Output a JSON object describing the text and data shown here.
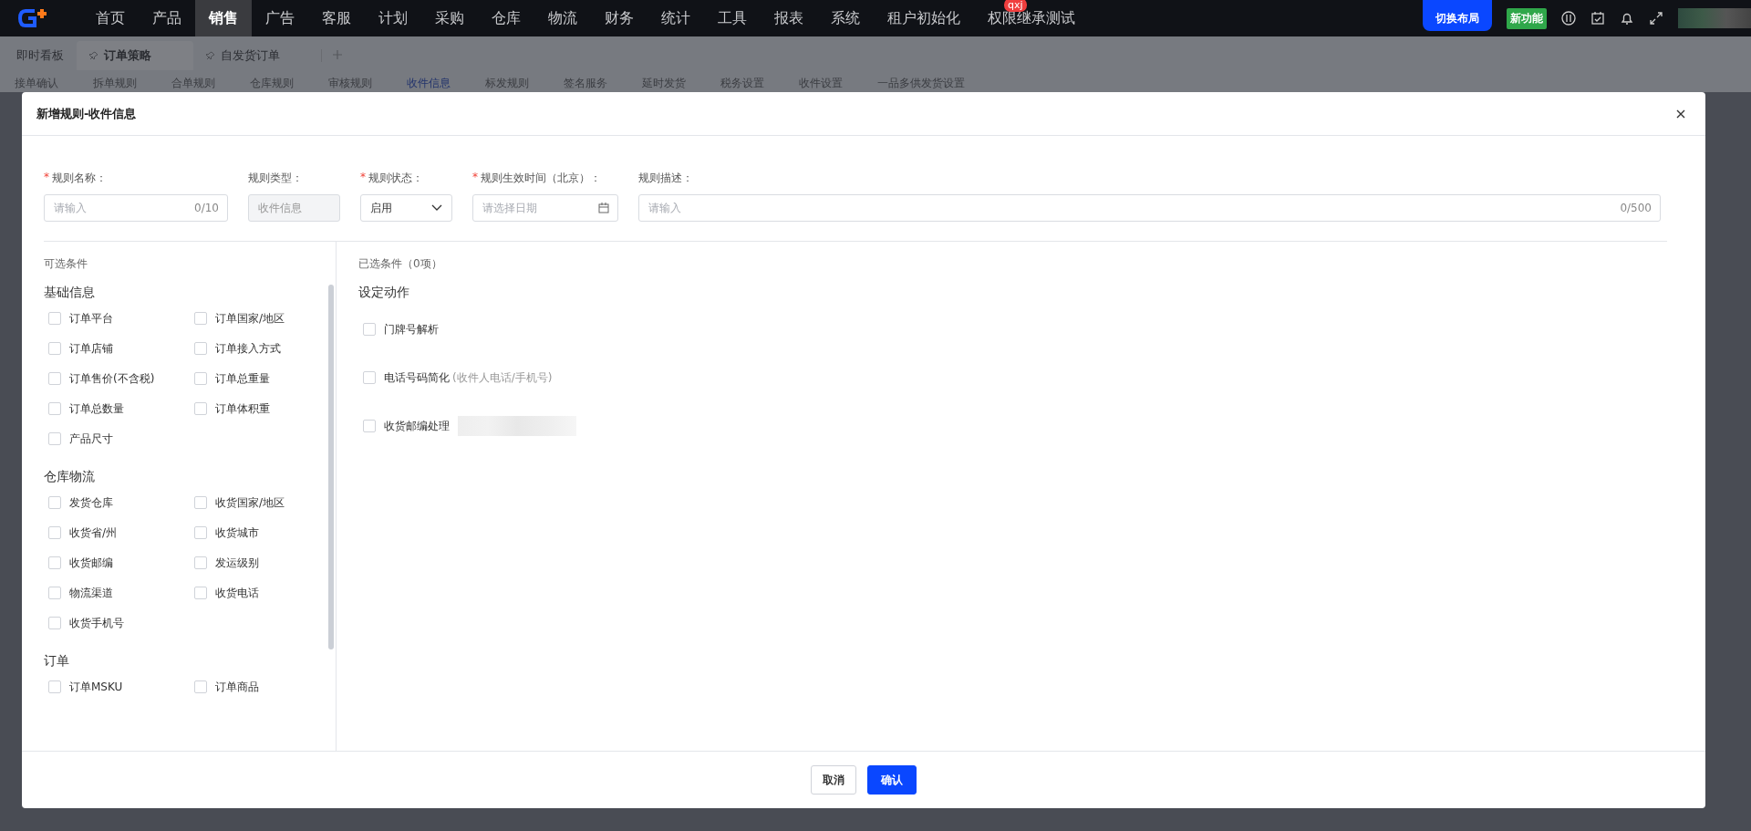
{
  "top_nav": {
    "items": [
      {
        "label": "首页",
        "selected": false
      },
      {
        "label": "产品",
        "selected": false
      },
      {
        "label": "销售",
        "selected": true
      },
      {
        "label": "广告",
        "selected": false
      },
      {
        "label": "客服",
        "selected": false
      },
      {
        "label": "计划",
        "selected": false
      },
      {
        "label": "采购",
        "selected": false
      },
      {
        "label": "仓库",
        "selected": false
      },
      {
        "label": "物流",
        "selected": false
      },
      {
        "label": "财务",
        "selected": false
      },
      {
        "label": "统计",
        "selected": false
      },
      {
        "label": "工具",
        "selected": false
      },
      {
        "label": "报表",
        "selected": false
      },
      {
        "label": "系统",
        "selected": false
      },
      {
        "label": "租户初始化",
        "selected": false
      },
      {
        "label": "权限继承测试",
        "selected": false,
        "badge": "qxj"
      }
    ],
    "switch_layout_button": "切换布局",
    "new_feature_badge": "新功能"
  },
  "page_tabs": [
    {
      "label": "即时看板",
      "selected": false,
      "pinned": false
    },
    {
      "label": "订单策略",
      "selected": true,
      "pinned": true
    },
    {
      "label": "自发货订单",
      "selected": false,
      "pinned": true
    }
  ],
  "sub_tabs": [
    {
      "label": "接单确认",
      "selected": false
    },
    {
      "label": "拆单规则",
      "selected": false
    },
    {
      "label": "合单规则",
      "selected": false
    },
    {
      "label": "仓库规则",
      "selected": false
    },
    {
      "label": "审核规则",
      "selected": false
    },
    {
      "label": "收件信息",
      "selected": true
    },
    {
      "label": "标发规则",
      "selected": false
    },
    {
      "label": "签名服务",
      "selected": false
    },
    {
      "label": "延时发货",
      "selected": false
    },
    {
      "label": "税务设置",
      "selected": false
    },
    {
      "label": "收件设置",
      "selected": false
    },
    {
      "label": "一品多供发货设置",
      "selected": false
    }
  ],
  "dialog": {
    "title": "新增规则-收件信息",
    "fields": [
      {
        "kind": "text",
        "label": "规则名称：",
        "required_mark": "*",
        "placeholder": "请输入",
        "counter": "0/10"
      },
      {
        "kind": "readonly",
        "label": "规则类型：",
        "value": "收件信息"
      },
      {
        "kind": "select",
        "label": "规则状态：",
        "required_mark": "*",
        "value": "启用"
      },
      {
        "kind": "date",
        "label": "规则生效时间（北京）：",
        "required_mark": "*",
        "placeholder": "请选择日期"
      },
      {
        "kind": "wide",
        "label": "规则描述：",
        "placeholder": "请输入",
        "counter": "0/500"
      }
    ],
    "available": {
      "title": "可选条件",
      "groups": [
        {
          "title": "基础信息",
          "items": [
            {
              "label": "订单平台",
              "checked": false
            },
            {
              "label": "订单国家/地区",
              "checked": false
            },
            {
              "label": "订单店铺",
              "checked": false
            },
            {
              "label": "订单接入方式",
              "checked": false
            },
            {
              "label": "订单售价(不含税)",
              "checked": false
            },
            {
              "label": "订单总重量",
              "checked": false
            },
            {
              "label": "订单总数量",
              "checked": false
            },
            {
              "label": "订单体积重",
              "checked": false
            },
            {
              "label": "产品尺寸",
              "checked": false
            }
          ]
        },
        {
          "title": "仓库物流",
          "items": [
            {
              "label": "发货仓库",
              "checked": false
            },
            {
              "label": "收货国家/地区",
              "checked": false
            },
            {
              "label": "收货省/州",
              "checked": false
            },
            {
              "label": "收货城市",
              "checked": false
            },
            {
              "label": "收货邮编",
              "checked": false
            },
            {
              "label": "发运级别",
              "checked": false
            },
            {
              "label": "物流渠道",
              "checked": false
            },
            {
              "label": "收货电话",
              "checked": false
            },
            {
              "label": "收货手机号",
              "checked": false
            }
          ]
        },
        {
          "title": "订单",
          "items": [
            {
              "label": "订单MSKU",
              "checked": false
            },
            {
              "label": "订单商品",
              "checked": false
            }
          ]
        }
      ]
    },
    "selected": {
      "title": "已选条件（0项）",
      "section": "设定动作",
      "actions": [
        {
          "label": "门牌号解析",
          "checked": false,
          "blurred": false
        },
        {
          "label": "电话号码简化",
          "hint": "(收件人电话/手机号)",
          "checked": false,
          "blurred": false
        },
        {
          "label": "收货邮编处理",
          "checked": false,
          "blurred": true
        }
      ]
    },
    "buttons": [
      {
        "label": "取消",
        "kind": "secondary"
      },
      {
        "label": "确认",
        "kind": "primary"
      }
    ]
  }
}
